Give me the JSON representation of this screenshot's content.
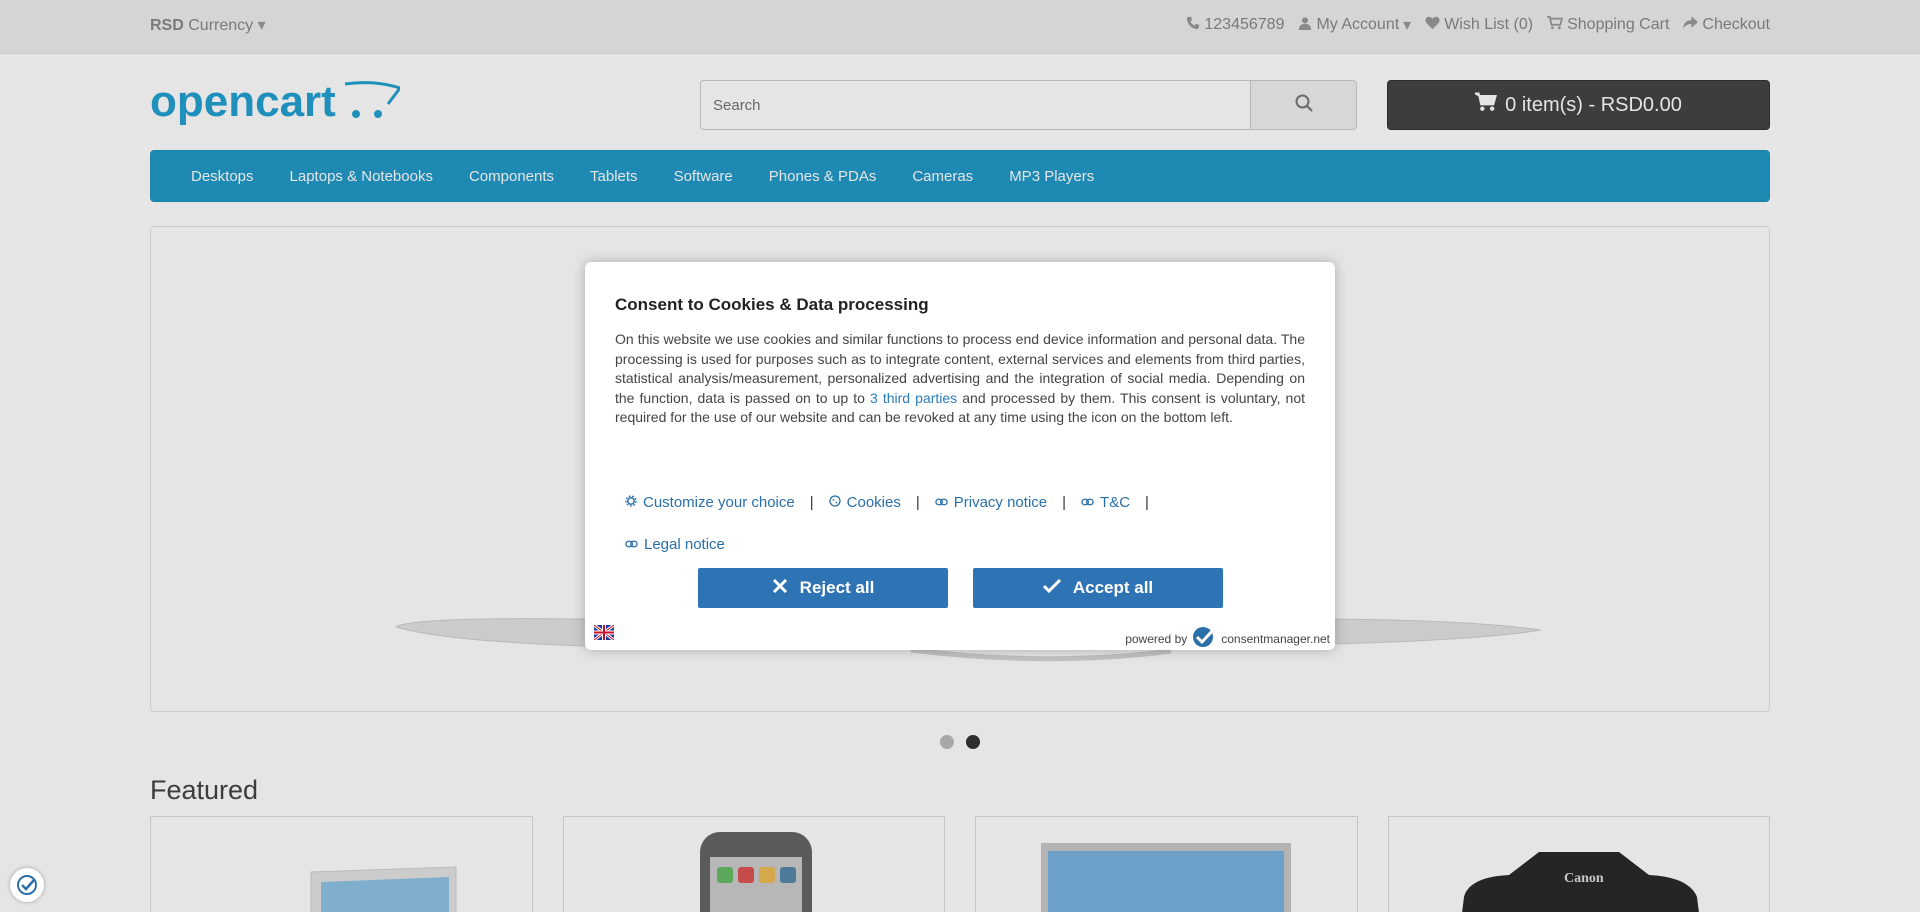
{
  "topbar": {
    "currency_code": "RSD",
    "currency_label": "Currency",
    "phone": "123456789",
    "my_account": "My Account",
    "wish_list": "Wish List (0)",
    "shopping_cart": "Shopping Cart",
    "checkout": "Checkout"
  },
  "header": {
    "logo_text": "opencart",
    "search_placeholder": "Search",
    "cart_label": "0 item(s) - RSD0.00"
  },
  "nav": {
    "items": [
      "Desktops",
      "Laptops & Notebooks",
      "Components",
      "Tablets",
      "Software",
      "Phones & PDAs",
      "Cameras",
      "MP3 Players"
    ]
  },
  "featured": {
    "title": "Featured"
  },
  "cookie": {
    "title": "Consent to Cookies & Data processing",
    "body_1": "On this website we use cookies and similar functions to process end device information and personal data. The processing is used for purposes such as to integrate content, external services and elements from third parties, statistical analysis/measurement, personalized advertising and the integration of social media. Depending on the function, data is passed on to up to ",
    "third_parties": "3 third parties",
    "body_2": " and processed by them. This consent is voluntary, not required for the use of our website and can be revoked at any time using the icon on the bottom left.",
    "links": {
      "customize": "Customize your choice",
      "cookies": "Cookies",
      "privacy": "Privacy notice",
      "tc": "T&C",
      "legal": "Legal notice"
    },
    "reject": "Reject all",
    "accept": "Accept all",
    "powered_by": "powered by",
    "brand": "consentmanager.net"
  },
  "colors": {
    "nav": "#229ac8",
    "button": "#2e73b4",
    "link": "#2a7bbd"
  }
}
